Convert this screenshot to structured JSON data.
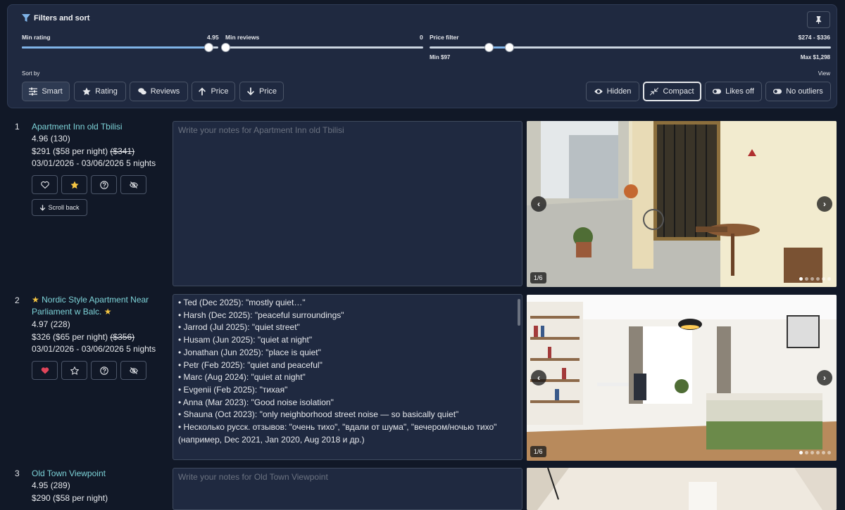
{
  "filters": {
    "title": "Filters and sort",
    "min_rating": {
      "label": "Min rating",
      "value": "4.95",
      "fraction": 0.97
    },
    "min_reviews": {
      "label": "Min reviews",
      "value": "0",
      "fraction": 0.0
    },
    "price": {
      "label": "Price filter",
      "range": "$274 - $336",
      "min_label": "Min $97",
      "max_label": "Max $1,298",
      "low_fraction": 0.148,
      "high_fraction": 0.2
    },
    "sort_by_label": "Sort by",
    "view_label": "View",
    "sort_buttons": [
      "Smart",
      "Rating",
      "Reviews",
      "Price",
      "Price"
    ],
    "view_buttons": [
      "Hidden",
      "Compact",
      "Likes off",
      "No outliers"
    ]
  },
  "listings": [
    {
      "index": "1",
      "name": "Apartment Inn old Tbilisi",
      "rating": "4.96 (130)",
      "price": "$291 ($58 per night)",
      "old_price": "($341)",
      "dates": "03/01/2026 - 03/06/2026 5 nights",
      "scroll_back": "Scroll back",
      "notes_placeholder": "Write your notes for Apartment Inn old Tbilisi",
      "photo_counter": "1/6"
    },
    {
      "index": "2",
      "name_star": "★",
      "name": "Nordic Style Apartment Near Parliament w Balc.",
      "rating": "4.97 (228)",
      "price": "$326 ($65 per night)",
      "old_price": "($356)",
      "dates": "03/01/2026 - 03/06/2026 5 nights",
      "notes_lines": [
        "• Ted (Dec 2025): \"mostly quiet…\"",
        "• Harsh (Dec 2025): \"peaceful surroundings\"",
        "• Jarrod (Jul 2025): \"quiet street\"",
        "• Husam (Jun 2025): \"quiet at night\"",
        "• Jonathan (Jun 2025): \"place is quiet\"",
        "• Petr (Feb 2025): \"quiet and peaceful\"",
        "• Marc (Aug 2024): \"quiet at night\"",
        "• Evgenii (Feb 2025): \"тихая\"",
        "• Anna (Mar 2023): \"Good noise isolation\"",
        "• Shauna (Oct 2023): \"only neighborhood street noise — so basically quiet\"",
        "• Несколько русск. отзывов: \"очень тихо\", \"вдали от шума\", \"вечером/ночью тихо\"",
        "(например, Dec 2021, Jan 2020, Aug 2018 и др.)"
      ],
      "photo_counter": "1/6"
    },
    {
      "index": "3",
      "name": "Old Town Viewpoint",
      "rating": "4.95 (289)",
      "price": "$290 ($58 per night)",
      "notes_placeholder": "Write your notes for Old Town Viewpoint"
    }
  ],
  "colors": {
    "accent": "#7dd3d8",
    "background": "#111827",
    "panel": "#1f2940",
    "star": "#f5c542",
    "heart": "#e0455a"
  }
}
